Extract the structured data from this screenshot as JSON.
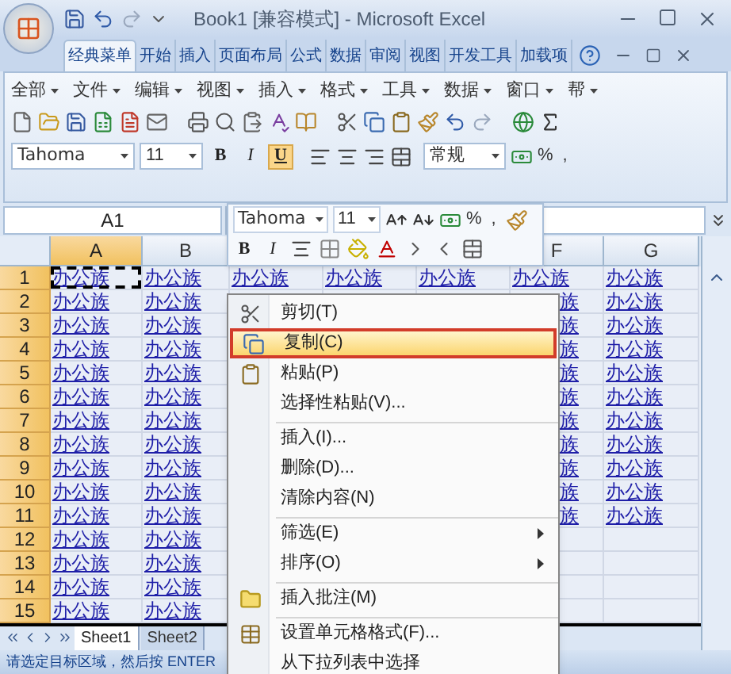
{
  "title_bar": {
    "title": "Book1  [兼容模式] - Microsoft Excel"
  },
  "ribbon_tabs": [
    {
      "label": "经典菜单",
      "selected": true
    },
    {
      "label": "开始",
      "selected": false
    },
    {
      "label": "插入",
      "selected": false
    },
    {
      "label": "页面布局",
      "selected": false
    },
    {
      "label": "公式",
      "selected": false
    },
    {
      "label": "数据",
      "selected": false
    },
    {
      "label": "审阅",
      "selected": false
    },
    {
      "label": "视图",
      "selected": false
    },
    {
      "label": "开发工具",
      "selected": false
    },
    {
      "label": "加载项",
      "selected": false
    }
  ],
  "classic_menu": [
    "全部",
    "文件",
    "编辑",
    "视图",
    "插入",
    "格式",
    "工具",
    "数据",
    "窗口",
    "帮"
  ],
  "format_bar": {
    "font": "Tahoma",
    "size": "11",
    "style_buttons": [
      {
        "label": "B",
        "active": false
      },
      {
        "label": "I",
        "active": false
      },
      {
        "label": "U",
        "active": true
      }
    ],
    "number_format": "常规",
    "percent": "%",
    "comma": ","
  },
  "name_box": "A1",
  "mini_toolbar": {
    "font": "Tahoma",
    "size": "11",
    "percent": "%",
    "comma": ",",
    "style_buttons": [
      "B",
      "I"
    ]
  },
  "columns": [
    {
      "label": "A",
      "selected": true
    },
    {
      "label": "B",
      "selected": false
    },
    null,
    null,
    null,
    {
      "label": "F",
      "selected": false
    },
    {
      "label": "G",
      "selected": false
    }
  ],
  "rows": [
    {
      "label": "1",
      "marquee": true,
      "cells": [
        "办公族",
        "办公族",
        "办公族",
        "办公族",
        "办公族",
        "办公族",
        "办公族"
      ]
    },
    {
      "label": "2",
      "marquee": false,
      "cells": [
        "办公族",
        "办公族",
        null,
        null,
        null,
        "族",
        "办公族"
      ]
    },
    {
      "label": "3",
      "marquee": false,
      "cells": [
        "办公族",
        "办公族",
        null,
        null,
        null,
        "族",
        "办公族"
      ]
    },
    {
      "label": "4",
      "marquee": false,
      "cells": [
        "办公族",
        "办公族",
        null,
        null,
        null,
        "族",
        "办公族"
      ]
    },
    {
      "label": "5",
      "marquee": false,
      "cells": [
        "办公族",
        "办公族",
        null,
        null,
        null,
        "族",
        "办公族"
      ]
    },
    {
      "label": "6",
      "marquee": false,
      "cells": [
        "办公族",
        "办公族",
        null,
        null,
        null,
        "族",
        "办公族"
      ]
    },
    {
      "label": "7",
      "marquee": false,
      "cells": [
        "办公族",
        "办公族",
        null,
        null,
        null,
        "族",
        "办公族"
      ]
    },
    {
      "label": "8",
      "marquee": false,
      "cells": [
        "办公族",
        "办公族",
        null,
        null,
        null,
        "族",
        "办公族"
      ]
    },
    {
      "label": "9",
      "marquee": false,
      "cells": [
        "办公族",
        "办公族",
        null,
        null,
        null,
        "族",
        "办公族"
      ]
    },
    {
      "label": "10",
      "marquee": false,
      "cells": [
        "办公族",
        "办公族",
        null,
        null,
        null,
        "族",
        "办公族"
      ]
    },
    {
      "label": "11",
      "marquee": false,
      "cells": [
        "办公族",
        "办公族",
        null,
        null,
        null,
        "族",
        "办公族"
      ]
    },
    {
      "label": "12",
      "marquee": false,
      "cells": [
        "办公族",
        "办公族",
        null,
        null,
        null,
        null,
        null
      ]
    },
    {
      "label": "13",
      "marquee": false,
      "cells": [
        "办公族",
        "办公族",
        null,
        null,
        null,
        null,
        null
      ]
    },
    {
      "label": "14",
      "marquee": false,
      "cells": [
        "办公族",
        "办公族",
        null,
        null,
        null,
        null,
        null
      ]
    },
    {
      "label": "15",
      "marquee": false,
      "cells": [
        "办公族",
        "办公族",
        null,
        null,
        null,
        null,
        null
      ]
    }
  ],
  "sheet_tabs": [
    {
      "label": "Sheet1",
      "selected": true
    },
    {
      "label": "Sheet2",
      "selected": false
    }
  ],
  "status_bar": "请选定目标区域，然后按 ENTER",
  "context_menu": [
    {
      "kind": "item",
      "label": "剪切(T)",
      "highlighted": false,
      "submenu": false
    },
    {
      "kind": "item",
      "label": "复制(C)",
      "highlighted": true,
      "submenu": false
    },
    {
      "kind": "item",
      "label": "粘贴(P)",
      "highlighted": false,
      "submenu": false
    },
    {
      "kind": "item",
      "label": "选择性粘贴(V)...",
      "highlighted": false,
      "submenu": false
    },
    {
      "kind": "separator"
    },
    {
      "kind": "item",
      "label": "插入(I)...",
      "highlighted": false,
      "submenu": false
    },
    {
      "kind": "item",
      "label": "删除(D)...",
      "highlighted": false,
      "submenu": false
    },
    {
      "kind": "item",
      "label": "清除内容(N)",
      "highlighted": false,
      "submenu": false
    },
    {
      "kind": "separator"
    },
    {
      "kind": "item",
      "label": "筛选(E)",
      "highlighted": false,
      "submenu": true
    },
    {
      "kind": "item",
      "label": "排序(O)",
      "highlighted": false,
      "submenu": true
    },
    {
      "kind": "separator"
    },
    {
      "kind": "item",
      "label": "插入批注(M)",
      "highlighted": false,
      "submenu": false
    },
    {
      "kind": "separator"
    },
    {
      "kind": "item",
      "label": "设置单元格格式(F)...",
      "highlighted": false,
      "submenu": false
    },
    {
      "kind": "item",
      "label": "从下拉列表中选择",
      "highlighted": false,
      "submenu": false
    }
  ]
}
